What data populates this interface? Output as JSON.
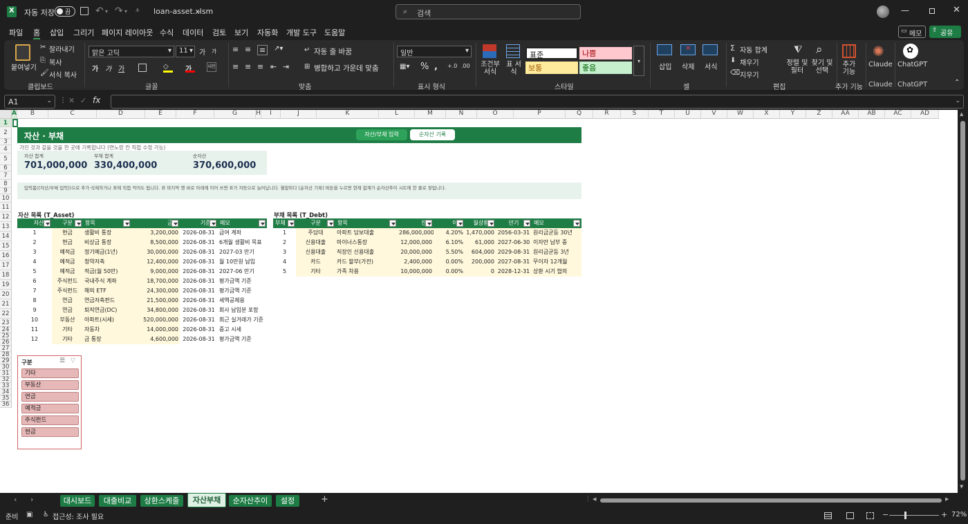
{
  "titlebar": {
    "autosave_label": "자동 저장",
    "autosave_state": "끔",
    "filename": "loan-asset.xlsm",
    "search_placeholder": "검색"
  },
  "menu": [
    "파일",
    "홈",
    "삽입",
    "그리기",
    "페이지 레이아웃",
    "수식",
    "데이터",
    "검토",
    "보기",
    "자동화",
    "개발 도구",
    "도움말"
  ],
  "menu_right": {
    "comment": "메모",
    "share": "공유"
  },
  "ribbon": {
    "clipboard": {
      "paste": "붙여넣기",
      "cut": "잘라내기",
      "copy": "복사",
      "format_painter": "서식 복사",
      "label": "클립보드"
    },
    "font": {
      "name": "맑은 고딕",
      "size": "11",
      "label": "글꼴",
      "bold": "가",
      "italic": "가",
      "underline": "가",
      "grow": "가",
      "shrink": "가",
      "color_a": "가",
      "phonetic": "내천"
    },
    "alignment": {
      "wrap": "자동 줄 바꿈",
      "merge": "병합하고 가운데 맞춤",
      "label": "맞춤"
    },
    "number": {
      "format": "일반",
      "label": "표시 형식",
      "percent": "%",
      "comma": ","
    },
    "styles": {
      "conditional": "조건부 서식",
      "table": "표 서식",
      "normal": "표준",
      "bad": "나쁨",
      "neutral": "보통",
      "good": "좋음",
      "label": "스타일"
    },
    "cells": {
      "insert": "삽입",
      "delete": "삭제",
      "format": "서식",
      "label": "셀"
    },
    "editing": {
      "autosum": "자동 합계",
      "fill": "채우기",
      "clear": "지우기",
      "sort": "정렬 및 필터",
      "find": "찾기 및 선택",
      "label": "편집"
    },
    "addins": {
      "add": "추가 기능",
      "label": "추가 기능"
    },
    "claude": {
      "name": "Claude",
      "label": "Claude"
    },
    "chatgpt": {
      "name": "ChatGPT",
      "label": "ChatGPT"
    }
  },
  "formula_bar": {
    "name_box": "A1",
    "fx": "fx",
    "value": ""
  },
  "columns": [
    "A",
    "B",
    "C",
    "D",
    "E",
    "F",
    "G",
    "H",
    "I",
    "J",
    "K",
    "L",
    "M",
    "N",
    "O",
    "P",
    "Q",
    "R",
    "S",
    "T",
    "U",
    "V",
    "W",
    "X",
    "Y",
    "Z",
    "AA",
    "AB",
    "AC",
    "AD"
  ],
  "rows_count": 36,
  "sheet": {
    "title": "자산 · 부채",
    "btn_input": "자산/부채 입력",
    "btn_record": "순자산 기록",
    "subtitle": "가진 것과 갚을 것을 한 곳에 기록합니다 (연노랑 칸 직접 수정 가능)",
    "summary": [
      {
        "label": "자산 합계",
        "value": "701,000,000"
      },
      {
        "label": "부채 합계",
        "value": "330,400,000"
      },
      {
        "label": "순자산",
        "value": "370,600,000"
      }
    ],
    "note": "입력폼([자산/부채 입력])으로 추가·삭제하거나 표에 직접 적어도 됩니다. 표 마지막 행 바로 아래에 이어 쓰면 표가 자동으로 늘어납니다. 월말마다 [순자산 기록] 버튼을 누르면 현재 합계가 순자산추이 시트에 한 줄로 쌓입니다."
  },
  "assets": {
    "title": "자산 목록 (T_Asset)",
    "headers": [
      "자산ID",
      "구분",
      "항목",
      "금액",
      "기준일",
      "메모"
    ],
    "rows": [
      [
        "1",
        "현금",
        "생활비 통장",
        "3,200,000",
        "2026-08-31",
        "급여 계좌"
      ],
      [
        "2",
        "현금",
        "비상금 통장",
        "8,500,000",
        "2026-08-31",
        "6개월 생활비 목표"
      ],
      [
        "3",
        "예적금",
        "정기예금(1년)",
        "30,000,000",
        "2026-08-31",
        "2027-03 만기"
      ],
      [
        "4",
        "예적금",
        "청약저축",
        "12,400,000",
        "2026-08-31",
        "월 10만원 납입"
      ],
      [
        "5",
        "예적금",
        "적금(월 50만)",
        "9,000,000",
        "2026-08-31",
        "2027-06 만기"
      ],
      [
        "6",
        "주식펀드",
        "국내주식 계좌",
        "18,700,000",
        "2026-08-31",
        "평가금액 기준"
      ],
      [
        "7",
        "주식펀드",
        "해외 ETF",
        "24,300,000",
        "2026-08-31",
        "평가금액 기준"
      ],
      [
        "8",
        "연금",
        "연금저축펀드",
        "21,500,000",
        "2026-08-31",
        "세액공제용"
      ],
      [
        "9",
        "연금",
        "퇴직연금(DC)",
        "34,800,000",
        "2026-08-31",
        "회사 납입분 포함"
      ],
      [
        "10",
        "부동산",
        "아파트(시세)",
        "520,000,000",
        "2026-08-31",
        "최근 실거래가 기준"
      ],
      [
        "11",
        "기타",
        "자동차",
        "14,000,000",
        "2026-08-31",
        "중고 시세"
      ],
      [
        "12",
        "기타",
        "금 통장",
        "4,600,000",
        "2026-08-31",
        "평가금액 기준"
      ]
    ]
  },
  "debts": {
    "title": "부채 목록 (T_Debt)",
    "headers": [
      "부채",
      "구분",
      "항목",
      "잔액",
      "이율",
      "월상환액",
      "만기",
      "메모"
    ],
    "rows": [
      [
        "1",
        "주담대",
        "아파트 담보대출",
        "286,000,000",
        "4.20%",
        "1,470,000",
        "2056-03-31",
        "원리금균등 30년"
      ],
      [
        "2",
        "신용대출",
        "마이너스통장",
        "12,000,000",
        "6.10%",
        "61,000",
        "2027-06-30",
        "이자만 납부 중"
      ],
      [
        "3",
        "신용대출",
        "직장인 신용대출",
        "20,000,000",
        "5.50%",
        "604,000",
        "2029-08-31",
        "원리금균등 3년"
      ],
      [
        "4",
        "카드",
        "카드 할부(가전)",
        "2,400,000",
        "0.00%",
        "200,000",
        "2027-08-31",
        "무이자 12개월"
      ],
      [
        "5",
        "기타",
        "가족 차용",
        "10,000,000",
        "0.00%",
        "0",
        "2028-12-31",
        "상환 시기 협의"
      ]
    ]
  },
  "slicer": {
    "title": "구분",
    "items": [
      "기타",
      "부동산",
      "연금",
      "예적금",
      "주식펀드",
      "현금"
    ]
  },
  "sheet_tabs": [
    "대시보드",
    "대출비교",
    "상환스케줄",
    "자산부채",
    "순자산추이",
    "설정"
  ],
  "active_tab": "자산부채",
  "status": {
    "ready": "준비",
    "accessibility": "접근성: 조사 필요",
    "zoom": "72%"
  },
  "colors": {
    "accent": "#1e7c45",
    "band": "#fff8dc",
    "header_green": "#1e7c45"
  }
}
